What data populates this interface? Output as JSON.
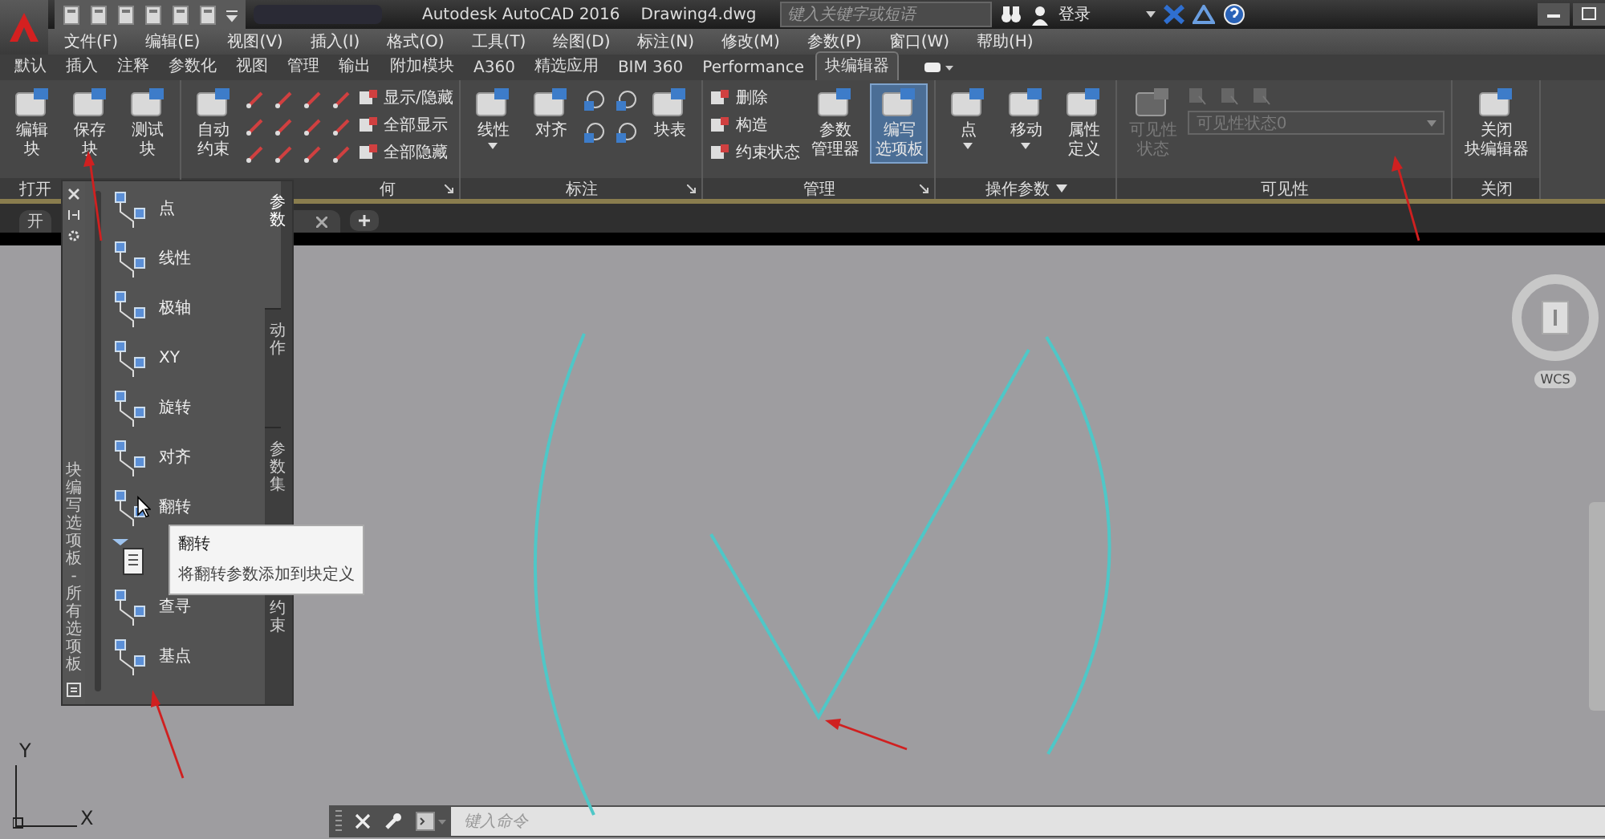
{
  "window": {
    "title": "Autodesk AutoCAD 2016",
    "document": "Drawing4.dwg"
  },
  "search": {
    "placeholder": "键入关键字或短语"
  },
  "account": {
    "label": "登录"
  },
  "menu": [
    "文件(F)",
    "编辑(E)",
    "视图(V)",
    "插入(I)",
    "格式(O)",
    "工具(T)",
    "绘图(D)",
    "标注(N)",
    "修改(M)",
    "参数(P)",
    "窗口(W)",
    "帮助(H)"
  ],
  "ribbon_tabs": [
    {
      "label": "默认",
      "selected": false
    },
    {
      "label": "插入",
      "selected": false
    },
    {
      "label": "注释",
      "selected": false
    },
    {
      "label": "参数化",
      "selected": false
    },
    {
      "label": "视图",
      "selected": false
    },
    {
      "label": "管理",
      "selected": false
    },
    {
      "label": "输出",
      "selected": false
    },
    {
      "label": "附加模块",
      "selected": false
    },
    {
      "label": "A360",
      "selected": false
    },
    {
      "label": "精选应用",
      "selected": false
    },
    {
      "label": "BIM 360",
      "selected": false
    },
    {
      "label": "Performance",
      "selected": false
    },
    {
      "label": "块编辑器",
      "selected": true
    }
  ],
  "ribbon_panels": [
    {
      "label": "打开",
      "menu": false,
      "tools": [
        {
          "kind": "large",
          "lines": [
            "编辑",
            "块"
          ],
          "caret": false,
          "selected": false,
          "disabled": false
        },
        {
          "kind": "large",
          "lines": [
            "保存",
            "块"
          ],
          "caret": false,
          "selected": false,
          "disabled": false
        },
        {
          "kind": "large",
          "lines": [
            "测试",
            "块"
          ],
          "caret": false,
          "selected": false,
          "disabled": false
        }
      ]
    },
    {
      "label": "何",
      "launcher": true,
      "menu": false,
      "tools": [
        {
          "kind": "large",
          "lines": [
            "自动",
            "约束"
          ],
          "caret": false,
          "selected": false,
          "disabled": false
        },
        {
          "kind": "icon_grid"
        },
        {
          "kind": "small_list",
          "items": [
            "显示/隐藏",
            "全部显示",
            "全部隐藏"
          ]
        }
      ]
    },
    {
      "label": "标注",
      "launcher": true,
      "menu": false,
      "tools": [
        {
          "kind": "large",
          "lines": [
            "线性"
          ],
          "caret": true,
          "selected": false,
          "disabled": false
        },
        {
          "kind": "large",
          "lines": [
            "对齐"
          ],
          "caret": false,
          "selected": false,
          "disabled": false
        },
        {
          "kind": "icon_pair"
        },
        {
          "kind": "large",
          "lines": [
            "块表"
          ],
          "caret": false,
          "selected": false,
          "disabled": false
        }
      ]
    },
    {
      "label": "管理",
      "launcher": true,
      "menu": false,
      "tools": [
        {
          "kind": "small_list",
          "items": [
            "删除",
            "构造",
            "约束状态"
          ]
        },
        {
          "kind": "large",
          "lines": [
            "参数",
            "管理器"
          ],
          "caret": false,
          "selected": false,
          "disabled": false
        },
        {
          "kind": "large",
          "lines": [
            "编写",
            "选项板"
          ],
          "caret": false,
          "selected": true,
          "disabled": false
        }
      ]
    },
    {
      "label": "操作参数",
      "launcher": false,
      "menu": true,
      "tools": [
        {
          "kind": "large",
          "lines": [
            "点"
          ],
          "caret": true,
          "selected": false,
          "disabled": false
        },
        {
          "kind": "large",
          "lines": [
            "移动"
          ],
          "caret": true,
          "selected": false,
          "disabled": false
        },
        {
          "kind": "large",
          "lines": [
            "属性",
            "定义"
          ],
          "caret": false,
          "selected": false,
          "disabled": false
        }
      ]
    },
    {
      "label": "可见性",
      "launcher": false,
      "menu": false,
      "tools": [
        {
          "kind": "large",
          "lines": [
            "可见性",
            "状态"
          ],
          "caret": false,
          "selected": false,
          "disabled": true
        },
        {
          "kind": "visibility",
          "dropdown": "可见性状态0",
          "disabled": true
        }
      ]
    },
    {
      "label": "关闭",
      "launcher": false,
      "menu": false,
      "tools": [
        {
          "kind": "large",
          "lines": [
            "关闭",
            "块编辑器"
          ],
          "caret": false,
          "selected": false,
          "disabled": false
        }
      ]
    }
  ],
  "file_tabs": [
    {
      "label": "开",
      "closable": false
    },
    {
      "closable": true
    }
  ],
  "palette": {
    "title": "块编写选项板 - 所有选项板",
    "tabs": [
      {
        "label": "参数",
        "selected": true
      },
      {
        "label": "动作",
        "selected": false
      },
      {
        "label": "参数集",
        "selected": false
      },
      {
        "label": "约束",
        "selected": false
      }
    ],
    "items": [
      {
        "kind": "tool",
        "label": "点"
      },
      {
        "kind": "tool",
        "label": "线性"
      },
      {
        "kind": "tool",
        "label": "极轴"
      },
      {
        "kind": "tool",
        "label": "XY"
      },
      {
        "kind": "tool",
        "label": "旋转"
      },
      {
        "kind": "tool",
        "label": "对齐"
      },
      {
        "kind": "tool",
        "label": "翻转"
      },
      {
        "kind": "icon"
      },
      {
        "kind": "tool",
        "label": "查寻"
      },
      {
        "kind": "tool",
        "label": "基点"
      }
    ]
  },
  "tooltip": {
    "title": "翻转",
    "description": "将翻转参数添加到块定义"
  },
  "viewcube": {
    "label": "WCS"
  },
  "ucs": {
    "x": "X",
    "y": "Y"
  },
  "command_line": {
    "placeholder": "键入命令"
  }
}
